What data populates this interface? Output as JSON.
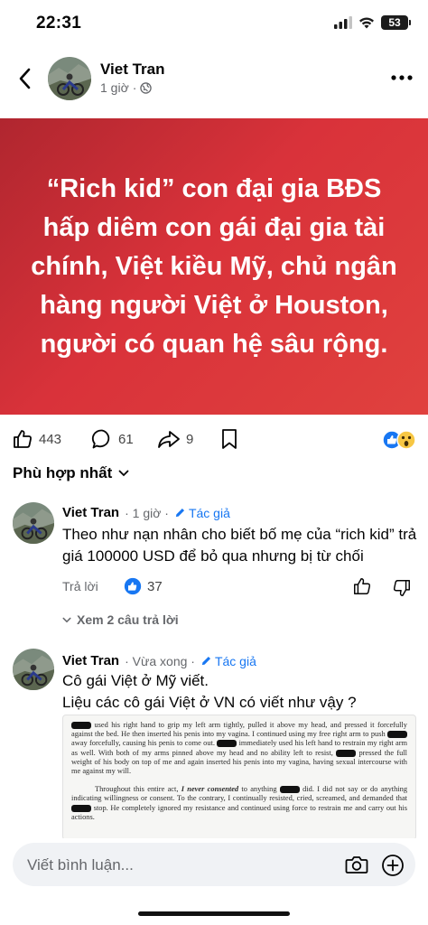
{
  "status_bar": {
    "time": "22:31",
    "battery": "53"
  },
  "post": {
    "author": "Viet Tran",
    "time": "1 giờ",
    "separator": "·",
    "banner_text": "“Rich kid” con đại gia BĐS hấp diêm con gái đại gia tài chính, Việt kiều Mỹ, chủ ngân hàng người Việt ở Houston, người có quan hệ sâu rộng.",
    "banner_color": "#d9323a",
    "likes": "443",
    "comments": "61",
    "shares": "9"
  },
  "sort_label": "Phù hợp nhất",
  "comments": [
    {
      "name": "Viet Tran",
      "time": "· 1 giờ ·",
      "author_tag": "Tác giả",
      "text": "Theo như nạn nhân cho biết bố mẹ của “rich kid” trả giá 100000 USD để bỏ qua nhưng bị từ chối",
      "reply": "Trả lời",
      "like_count": "37",
      "see_replies": "Xem 2 câu trả lời"
    },
    {
      "name": "Viet Tran",
      "time": "· Vừa xong ·",
      "author_tag": "Tác giả",
      "line1": "Cô gái Việt ở Mỹ viết.",
      "line2": "Liệu các cô gái Việt ở VN có viết như vậy ?",
      "doc": {
        "p1_a": "used his right hand to grip my left arm tightly, pulled it above my head, and pressed it forcefully against the bed. He then inserted his penis into my vagina. I continued using my free right arm to push",
        "p1_b": "away forcefully, causing his penis to come out.",
        "p1_c": "immediately used his left hand to restrain my right arm as well. With both of my arms pinned above my head and no ability left to resist,",
        "p1_d": "pressed the full weight of his body on top of me and again inserted his penis into my vagina, having sexual intercourse with me against my will.",
        "p2_a": "Throughout this entire act,",
        "p2_em": "I never consented",
        "p2_b": "to anything",
        "p2_c": "did. I did not say or do anything indicating willingness or consent. To the contrary, I continually resisted, cried, screamed, and demanded that",
        "p2_d": "stop. He completely ignored my resistance and continued using force to restrain me and carry out his actions."
      }
    }
  ],
  "composer": {
    "placeholder": "Viết bình luận..."
  },
  "colors": {
    "link": "#1877f2",
    "muted": "#65676b",
    "input_bg": "#f0f2f5"
  },
  "icons": [
    "back-icon",
    "globe-icon",
    "more-icon",
    "like-icon",
    "comment-icon",
    "share-icon",
    "bookmark-icon",
    "chevron-down-icon",
    "pencil-icon",
    "thumbs-up-icon",
    "thumbs-down-icon",
    "camera-icon",
    "plus-icon"
  ]
}
